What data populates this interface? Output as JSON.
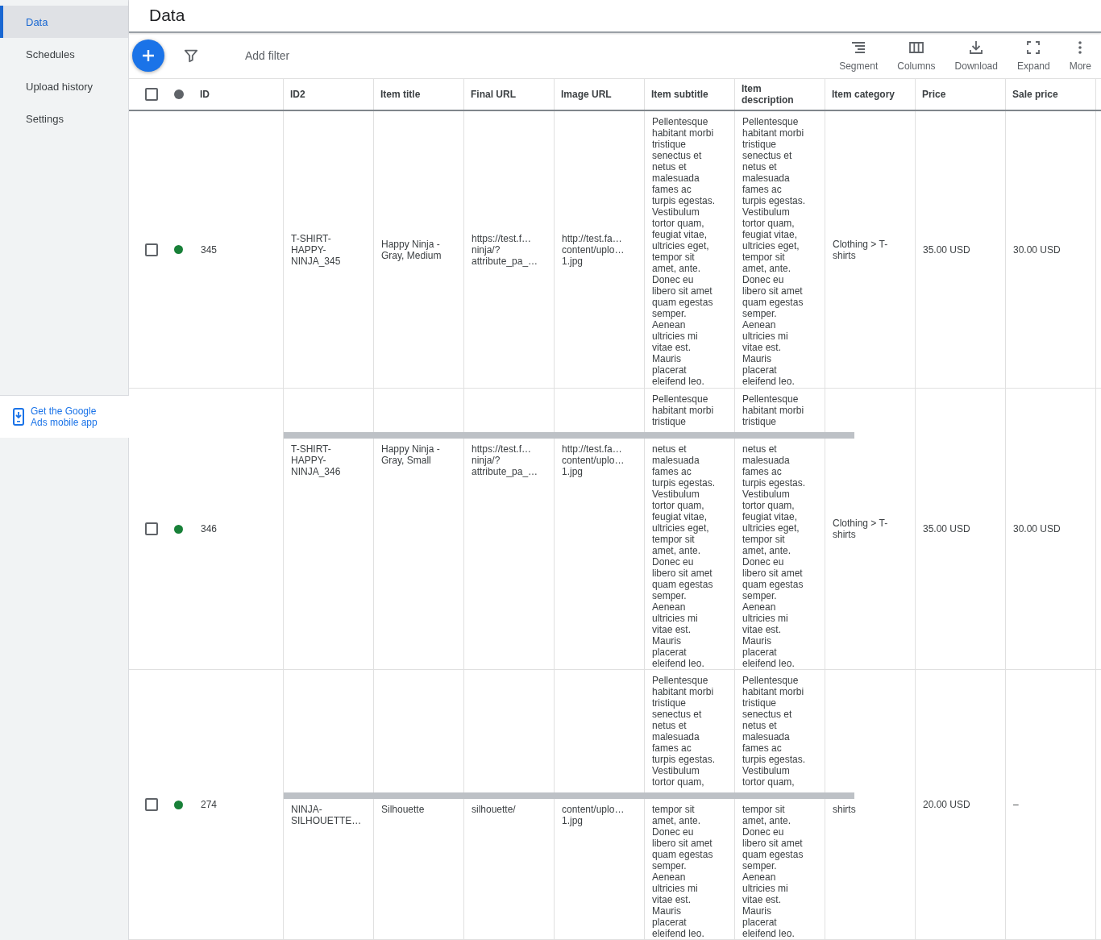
{
  "sidebar": {
    "items": [
      {
        "label": "Data",
        "selected": true
      },
      {
        "label": "Schedules",
        "selected": false
      },
      {
        "label": "Upload history",
        "selected": false
      },
      {
        "label": "Settings",
        "selected": false
      }
    ],
    "promo": {
      "text": "Get the Google\nAds mobile app"
    }
  },
  "page_title": "Data",
  "toolbar": {
    "filter_label": "Add filter",
    "actions": [
      {
        "kind": "segment",
        "label": "Segment"
      },
      {
        "kind": "columns",
        "label": "Columns"
      },
      {
        "kind": "download",
        "label": "Download"
      },
      {
        "kind": "expand",
        "label": "Expand"
      },
      {
        "kind": "more",
        "label": "More"
      }
    ]
  },
  "table": {
    "select_all": {
      "checked": false
    },
    "columns": [
      "ID",
      "ID2",
      "Item title",
      "Final URL",
      "Image URL",
      "Item subtitle",
      "Item\ndescription",
      "Item category",
      "Price",
      "Sale price"
    ],
    "rows": [
      {
        "kind": "plain",
        "checked": false,
        "color": "#188038",
        "cells": [
          {
            "text": "345"
          },
          {
            "text": "T-SHIRT-\nHAPPY-\nNINJA_345"
          },
          {
            "text": "Happy Ninja -\nGray, Medium"
          },
          {
            "text": "https://test.f…\nninja/?\nattribute_pa_…"
          },
          {
            "text": "http://test.fa…\ncontent/uplo…\n1.jpg"
          },
          {
            "text": "Pellentesque\nhabitant morbi\ntristique\nsenectus et\nnetus et\nmalesuada\nfames ac\nturpis egestas.\nVestibulum\ntortor quam,\nfeugiat vitae,\nultricies eget,\ntempor sit\namet, ante.\nDonec eu\nlibero sit amet\nquam egestas\nsemper.\nAenean\nultricies mi\nvitae est.\nMauris\nplacerat\neleifend leo."
          },
          {
            "text": "Pellentesque\nhabitant morbi\ntristique\nsenectus et\nnetus et\nmalesuada\nfames ac\nturpis egestas.\nVestibulum\ntortor quam,\nfeugiat vitae,\nultricies eget,\ntempor sit\namet, ante.\nDonec eu\nlibero sit amet\nquam egestas\nsemper.\nAenean\nultricies mi\nvitae est.\nMauris\nplacerat\neleifend leo."
          },
          {
            "text": "Clothing > T-\nshirts"
          },
          {
            "text": "35.00 USD"
          },
          {
            "text": "30.00 USD"
          }
        ]
      },
      {
        "kind": "split",
        "checked": false,
        "color": "#188038",
        "cells": [
          {
            "text": "346"
          },
          {
            "below": "T-SHIRT-\nHAPPY-\nNINJA_346"
          },
          {
            "below": "Happy Ninja -\nGray, Small"
          },
          {
            "below": "https://test.f…\nninja/?\nattribute_pa_…"
          },
          {
            "below": "http://test.fa…\ncontent/uplo…\n1.jpg"
          },
          {
            "above": "Pellentesque\nhabitant morbi\ntristique",
            "below": "netus et\nmalesuada\nfames ac\nturpis egestas.\nVestibulum\ntortor quam,\nfeugiat vitae,\nultricies eget,\ntempor sit\namet, ante.\nDonec eu\nlibero sit amet\nquam egestas\nsemper.\nAenean\nultricies mi\nvitae est.\nMauris\nplacerat\neleifend leo."
          },
          {
            "above": "Pellentesque\nhabitant morbi\ntristique",
            "below": "netus et\nmalesuada\nfames ac\nturpis egestas.\nVestibulum\ntortor quam,\nfeugiat vitae,\nultricies eget,\ntempor sit\namet, ante.\nDonec eu\nlibero sit amet\nquam egestas\nsemper.\nAenean\nultricies mi\nvitae est.\nMauris\nplacerat\neleifend leo."
          },
          {
            "text": "Clothing > T-\nshirts"
          },
          {
            "text": "35.00 USD"
          },
          {
            "text": "30.00 USD"
          }
        ]
      },
      {
        "kind": "split",
        "checked": false,
        "color": "#188038",
        "cells": [
          {
            "text": "274"
          },
          {
            "below": "NINJA-\nSILHOUETTE…"
          },
          {
            "below": "Silhouette"
          },
          {
            "below": "silhouette/"
          },
          {
            "below": "content/uplo…\n1.jpg"
          },
          {
            "above": "Pellentesque\nhabitant morbi\ntristique\nsenectus et\nnetus et\nmalesuada\nfames ac\nturpis egestas.\nVestibulum\ntortor quam,",
            "below": "tempor sit\namet, ante.\nDonec eu\nlibero sit amet\nquam egestas\nsemper.\nAenean\nultricies mi\nvitae est.\nMauris\nplacerat\neleifend leo."
          },
          {
            "above": "Pellentesque\nhabitant morbi\ntristique\nsenectus et\nnetus et\nmalesuada\nfames ac\nturpis egestas.\nVestibulum\ntortor quam,",
            "below": "tempor sit\namet, ante.\nDonec eu\nlibero sit amet\nquam egestas\nsemper.\nAenean\nultricies mi\nvitae est.\nMauris\nplacerat\neleifend leo."
          },
          {
            "below": "shirts"
          },
          {
            "text": "20.00 USD"
          },
          {
            "text": "–"
          }
        ]
      }
    ]
  }
}
